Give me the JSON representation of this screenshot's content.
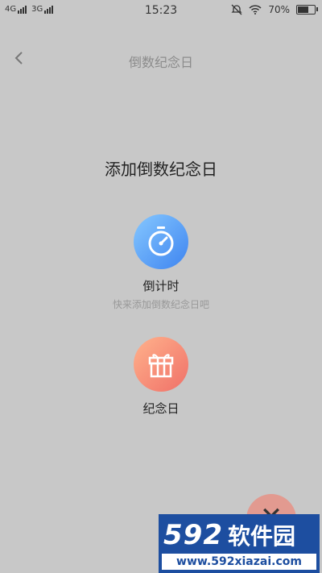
{
  "status_bar": {
    "sim1": "4G",
    "sim2": "3G",
    "time": "15:23",
    "battery": "70%",
    "battery_level": 0.7
  },
  "header": {
    "back_icon": "chevron-left-icon",
    "title": "倒数纪念日"
  },
  "dialog": {
    "title": "添加倒数纪念日",
    "options": [
      {
        "label": "倒计时",
        "subtitle": "快来添加倒数纪念日吧",
        "icon": "stopwatch-icon",
        "color": "#5a9bf5"
      },
      {
        "label": "纪念日",
        "icon": "gift-icon",
        "color": "#f58a76"
      }
    ],
    "close_icon": "close-icon"
  },
  "watermark": {
    "logo_number": "592",
    "logo_text": "软件园",
    "url": "www.592xiazai.com"
  }
}
